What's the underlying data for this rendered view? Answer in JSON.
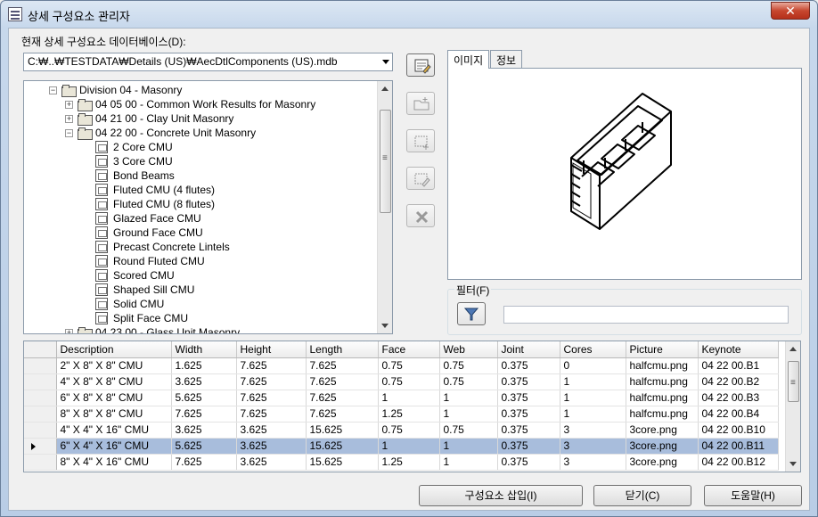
{
  "window": {
    "title": "상세 구성요소 관리자",
    "close_glyph": "✕"
  },
  "database": {
    "label": "현재 상세 구성요소 데이터베이스(D):",
    "path": "C:₩..₩TESTDATA₩Details (US)₩AecDtlComponents (US).mdb"
  },
  "tree": {
    "items": [
      {
        "label": "Division 04 - Masonry",
        "kind": "folder",
        "expander": "−"
      },
      {
        "label": "04 05 00 - Common Work Results for Masonry",
        "kind": "folder",
        "expander": "+"
      },
      {
        "label": "04 21 00 - Clay Unit Masonry",
        "kind": "folder",
        "expander": "+"
      },
      {
        "label": "04 22 00 - Concrete Unit Masonry",
        "kind": "folder",
        "expander": "−"
      },
      {
        "label": "2 Core CMU",
        "kind": "file"
      },
      {
        "label": "3 Core CMU",
        "kind": "file"
      },
      {
        "label": "Bond Beams",
        "kind": "file"
      },
      {
        "label": "Fluted CMU (4 flutes)",
        "kind": "file"
      },
      {
        "label": "Fluted CMU (8 flutes)",
        "kind": "file"
      },
      {
        "label": "Glazed Face CMU",
        "kind": "file"
      },
      {
        "label": "Ground Face CMU",
        "kind": "file"
      },
      {
        "label": "Precast Concrete Lintels",
        "kind": "file"
      },
      {
        "label": "Round Fluted CMU",
        "kind": "file"
      },
      {
        "label": "Scored CMU",
        "kind": "file"
      },
      {
        "label": "Shaped Sill CMU",
        "kind": "file"
      },
      {
        "label": "Solid CMU",
        "kind": "file"
      },
      {
        "label": "Split Face CMU",
        "kind": "file"
      },
      {
        "label": "04 23 00 - Glass Unit Masonry",
        "kind": "folder",
        "expander": "+"
      }
    ]
  },
  "side_buttons": [
    {
      "name": "edit-database-button",
      "icon": "edit-database-icon",
      "enabled": true
    },
    {
      "name": "add-component-group-button",
      "icon": "add-folder-icon",
      "enabled": false
    },
    {
      "name": "add-component-button",
      "icon": "add-component-icon",
      "enabled": false
    },
    {
      "name": "edit-component-button",
      "icon": "edit-component-icon",
      "enabled": false
    },
    {
      "name": "delete-component-button",
      "icon": "delete-icon",
      "enabled": false
    }
  ],
  "tabs": [
    {
      "label": "이미지",
      "active": true
    },
    {
      "label": "정보",
      "active": false
    }
  ],
  "preview": {
    "subject": "3 core CMU block isometric drawing"
  },
  "filter": {
    "label": "필터(F)",
    "value": ""
  },
  "table": {
    "headers": [
      "Description",
      "Width",
      "Height",
      "Length",
      "Face",
      "Web",
      "Joint",
      "Cores",
      "Picture",
      "Keynote"
    ],
    "rows": [
      [
        "2\" X 8\" X 8\" CMU",
        "1.625",
        "7.625",
        "7.625",
        "0.75",
        "0.75",
        "0.375",
        "0",
        "halfcmu.png",
        "04 22 00.B1"
      ],
      [
        "4\" X 8\" X 8\" CMU",
        "3.625",
        "7.625",
        "7.625",
        "0.75",
        "0.75",
        "0.375",
        "1",
        "halfcmu.png",
        "04 22 00.B2"
      ],
      [
        "6\" X 8\" X 8\" CMU",
        "5.625",
        "7.625",
        "7.625",
        "1",
        "1",
        "0.375",
        "1",
        "halfcmu.png",
        "04 22 00.B3"
      ],
      [
        "8\" X 8\" X 8\" CMU",
        "7.625",
        "7.625",
        "7.625",
        "1.25",
        "1",
        "0.375",
        "1",
        "halfcmu.png",
        "04 22 00.B4"
      ],
      [
        "4\" X 4\" X 16\" CMU",
        "3.625",
        "3.625",
        "15.625",
        "0.75",
        "0.75",
        "0.375",
        "3",
        "3core.png",
        "04 22 00.B10"
      ],
      [
        "6\" X 4\" X 16\" CMU",
        "5.625",
        "3.625",
        "15.625",
        "1",
        "1",
        "0.375",
        "3",
        "3core.png",
        "04 22 00.B11"
      ],
      [
        "8\" X 4\" X 16\" CMU",
        "7.625",
        "3.625",
        "15.625",
        "1.25",
        "1",
        "0.375",
        "3",
        "3core.png",
        "04 22 00.B12"
      ]
    ],
    "selected_row": 5
  },
  "buttons": {
    "insert": "구성요소 삽입(I)",
    "close": "닫기(C)",
    "help": "도움말(H)"
  },
  "colors": {
    "selection": "#a8bddc",
    "close_button": "#c7472f"
  }
}
